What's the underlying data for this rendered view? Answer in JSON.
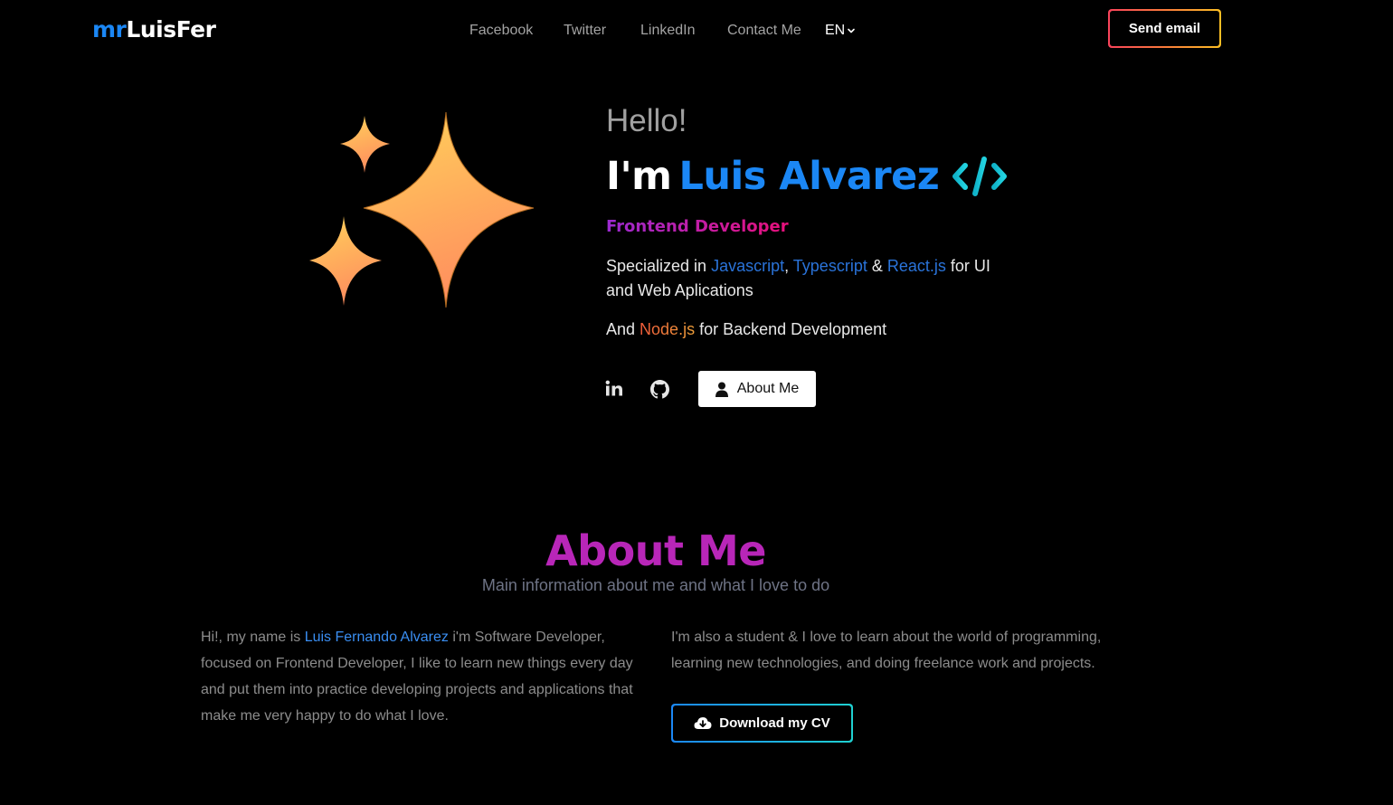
{
  "header": {
    "logo_prefix": "mr",
    "logo_name": "LuisFer",
    "nav": [
      "Facebook",
      "Twitter",
      "LinkedIn",
      "Contact Me"
    ],
    "language": "EN",
    "send_email_label": "Send email"
  },
  "hero": {
    "greeting": "Hello!",
    "intro": "I'm",
    "name": "Luis Alvarez",
    "role": "Frontend Developer",
    "specialized_prefix": "Specialized in ",
    "tech1": "Javascript",
    "sep1": ", ",
    "tech2": "Typescript",
    "sep2": " & ",
    "tech3": "React.js",
    "specialized_suffix": " for UI and Web Aplications",
    "backend_prefix": "And ",
    "backend_tech": "Node.js",
    "backend_suffix": " for Backend Development",
    "about_button_label": "About Me"
  },
  "about": {
    "title": "About Me",
    "subtitle": "Main information about me and what I love to do",
    "left_prefix": "Hi!, my name is ",
    "left_name": "Luis Fernando Alvarez",
    "left_suffix": " i'm Software Developer, focused on Frontend Developer, I like to learn new things every day and put them into practice developing projects and applications that make me very happy to do what I love.",
    "right_text": "I'm also a student & I love to learn about the world of programming, learning new technologies, and doing freelance work and projects.",
    "download_label": "Download my CV"
  },
  "colors": {
    "accent_blue": "#1b87f5",
    "accent_purple": "#b826b8",
    "accent_teal": "#1fd1d1"
  },
  "icons": [
    "sparkles-icon",
    "code-icon",
    "linkedin-icon",
    "github-icon",
    "user-icon",
    "cloud-download-icon",
    "chevron-down-icon"
  ]
}
